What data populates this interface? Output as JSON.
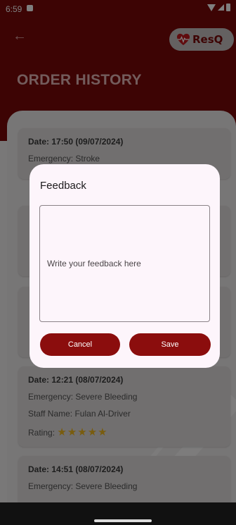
{
  "status_bar": {
    "time": "6:59"
  },
  "header": {
    "logo_text": "ResQ",
    "page_title": "ORDER HISTORY"
  },
  "orders": [
    {
      "date": "Date: 17:50 (09/07/2024)",
      "emergency": "Emergency: Stroke"
    },
    {
      "date": "Date: 12:21 (08/07/2024)",
      "emergency": "Emergency: Severe Bleeding",
      "staff": "Staff Name: Fulan Al-Driver",
      "rating_label": "Rating:",
      "rating_stars": "★★★★★",
      "rating_value": 5
    },
    {
      "date": "Date: 14:51 (08/07/2024)",
      "emergency": "Emergency: Severe Bleeding"
    }
  ],
  "dialog": {
    "title": "Feedback",
    "placeholder": "Write your feedback here",
    "cancel_label": "Cancel",
    "save_label": "Save"
  },
  "colors": {
    "brand_dark_red": "#7a0808",
    "button_red": "#8b0d0d",
    "star_gold": "#f2b81d",
    "dialog_bg": "#fdf5fb"
  }
}
